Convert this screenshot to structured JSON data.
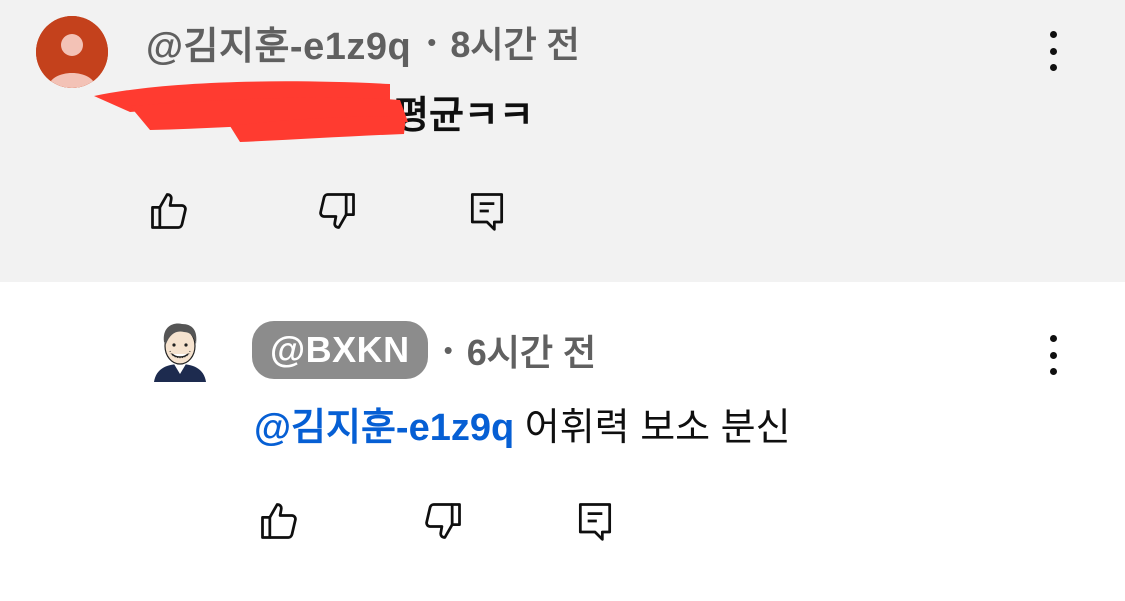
{
  "comments": [
    {
      "author": "@김지훈-e1z9q",
      "separator": "•",
      "time": "8시간 전",
      "text_tail": "평균ㅋㅋ",
      "redaction_color": "#ff3b30",
      "avatar_icon": "default-person-icon",
      "avatar_color": "#c4411c",
      "actions": [
        "like-icon",
        "dislike-icon",
        "reply-icon"
      ],
      "menu_icon": "more-vertical-icon"
    },
    {
      "author": "@BXKN",
      "separator": "•",
      "time": "6시간 전",
      "mention": "@김지훈-e1z9q",
      "text": " 어휘력 보소 분신",
      "avatar_icon": "cartoon-portrait-icon",
      "actions": [
        "like-icon",
        "dislike-icon",
        "reply-icon"
      ],
      "menu_icon": "more-vertical-icon"
    }
  ],
  "colors": {
    "highlight_bg": "#f2f2f2",
    "mention": "#065fd4",
    "pill_bg": "#8c8c8c",
    "meta_text": "#606060"
  }
}
